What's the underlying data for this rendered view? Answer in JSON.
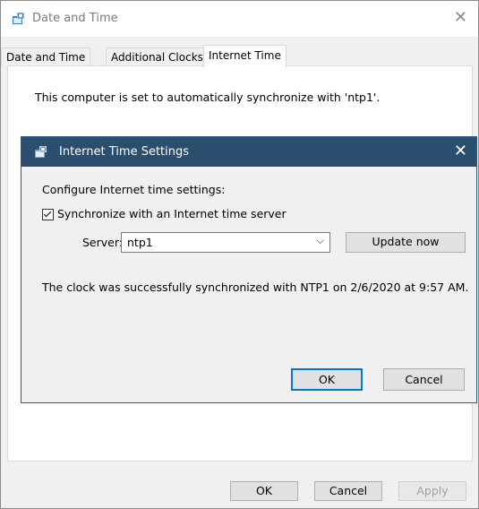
{
  "window": {
    "title": "Date and Time",
    "close_glyph": "✕",
    "tabs": [
      {
        "label": "Date and Time"
      },
      {
        "label": "Additional Clocks"
      },
      {
        "label": "Internet Time"
      }
    ],
    "sync_message": "This computer is set to automatically synchronize with 'ntp1'.",
    "buttons": {
      "ok": "OK",
      "cancel": "Cancel",
      "apply": "Apply"
    }
  },
  "dialog": {
    "title": "Internet Time Settings",
    "close_glyph": "✕",
    "configure_label": "Configure Internet time settings:",
    "sync_checkbox_label": "Synchronize with an Internet time server",
    "sync_checked": true,
    "server_label": "Server:",
    "server_value": "ntp1",
    "update_button": "Update now",
    "status_message": "The clock was successfully synchronized with NTP1 on 2/6/2020 at 9:57 AM.",
    "buttons": {
      "ok": "OK",
      "cancel": "Cancel"
    }
  },
  "colors": {
    "dialog_titlebar": "#2b4d6e",
    "accent_border": "#0078d7"
  },
  "icons": {
    "app": "date-time-control-panel-icon",
    "dropdown": "chevron-down-icon"
  }
}
